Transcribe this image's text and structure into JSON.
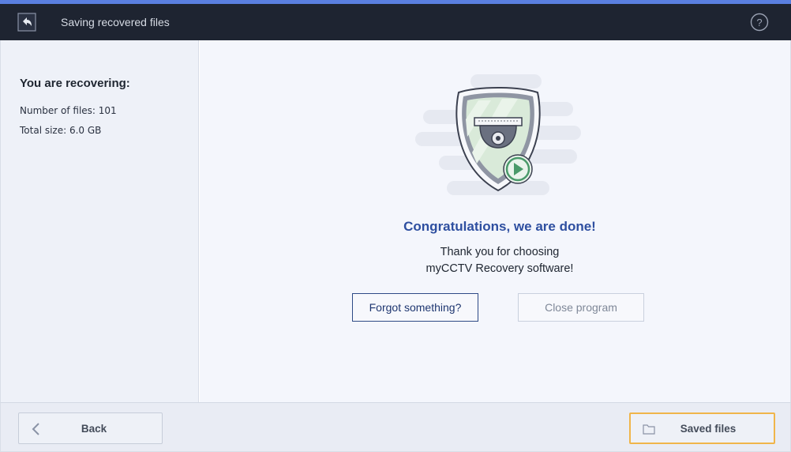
{
  "window": {
    "title": "Saving recovered files",
    "icons": {
      "app": "back-arrow-app-icon",
      "help": "help-circle-icon"
    }
  },
  "sidebar": {
    "heading": "You are recovering:",
    "files_label": "Number of files: 101",
    "size_label": "Total size: 6.0 GB"
  },
  "main": {
    "illustration": "shield-cctv-camera-play-icon",
    "congrats": "Congratulations, we are done!",
    "thanks_line1": "Thank you for choosing",
    "thanks_line2": "myCCTV Recovery software!",
    "forgot_button": "Forgot something?",
    "close_button": "Close program"
  },
  "footer": {
    "back_button": "Back",
    "saved_button": "Saved files",
    "icons": {
      "back": "chevron-left-icon",
      "saved": "folder-icon"
    }
  },
  "colors": {
    "header_bg": "#1e2431",
    "accent_strip": "#5a7fe0",
    "congrats_text": "#2e4fa0",
    "saved_button_border": "#f0b54a",
    "shield_green": "#d4e8d4",
    "play_green": "#4a9a6a"
  }
}
